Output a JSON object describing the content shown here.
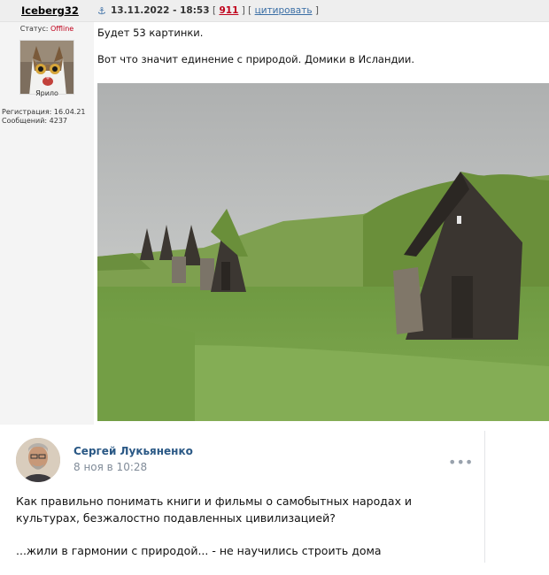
{
  "forum_post": {
    "username": "Iceberg32",
    "anchor_icon": "anchor-icon",
    "date": "13.11.2022 - 18:53",
    "actions": {
      "open": "[",
      "number": "911",
      "separator": "] [",
      "quote": "цитировать",
      "close": "]"
    },
    "status_label": "Статус:",
    "status_value": "Offline",
    "rank": "Ярило",
    "registration": "Регистрация: 16.04.21",
    "messages": "Сообщений: 4237",
    "text_line1": "Будет 53 картинки.",
    "text_line2": "Вот что значит единение с природой. Домики в Исландии."
  },
  "vk_post": {
    "author": "Сергей Лукьяненко",
    "date": "8 ноя в 10:28",
    "more_label": "•••",
    "paragraph1": "Как правильно понимать книги и фильмы о самобытных народах и культурах, безжалостно подавленных цивилизацией?",
    "paragraph2": "...жили в гармонии с природой... - не научились строить дома"
  },
  "colors": {
    "header_bg": "#eeeeee",
    "offline": "#c0001b",
    "vk_link": "#2a5885",
    "vk_meta": "#818c99"
  }
}
